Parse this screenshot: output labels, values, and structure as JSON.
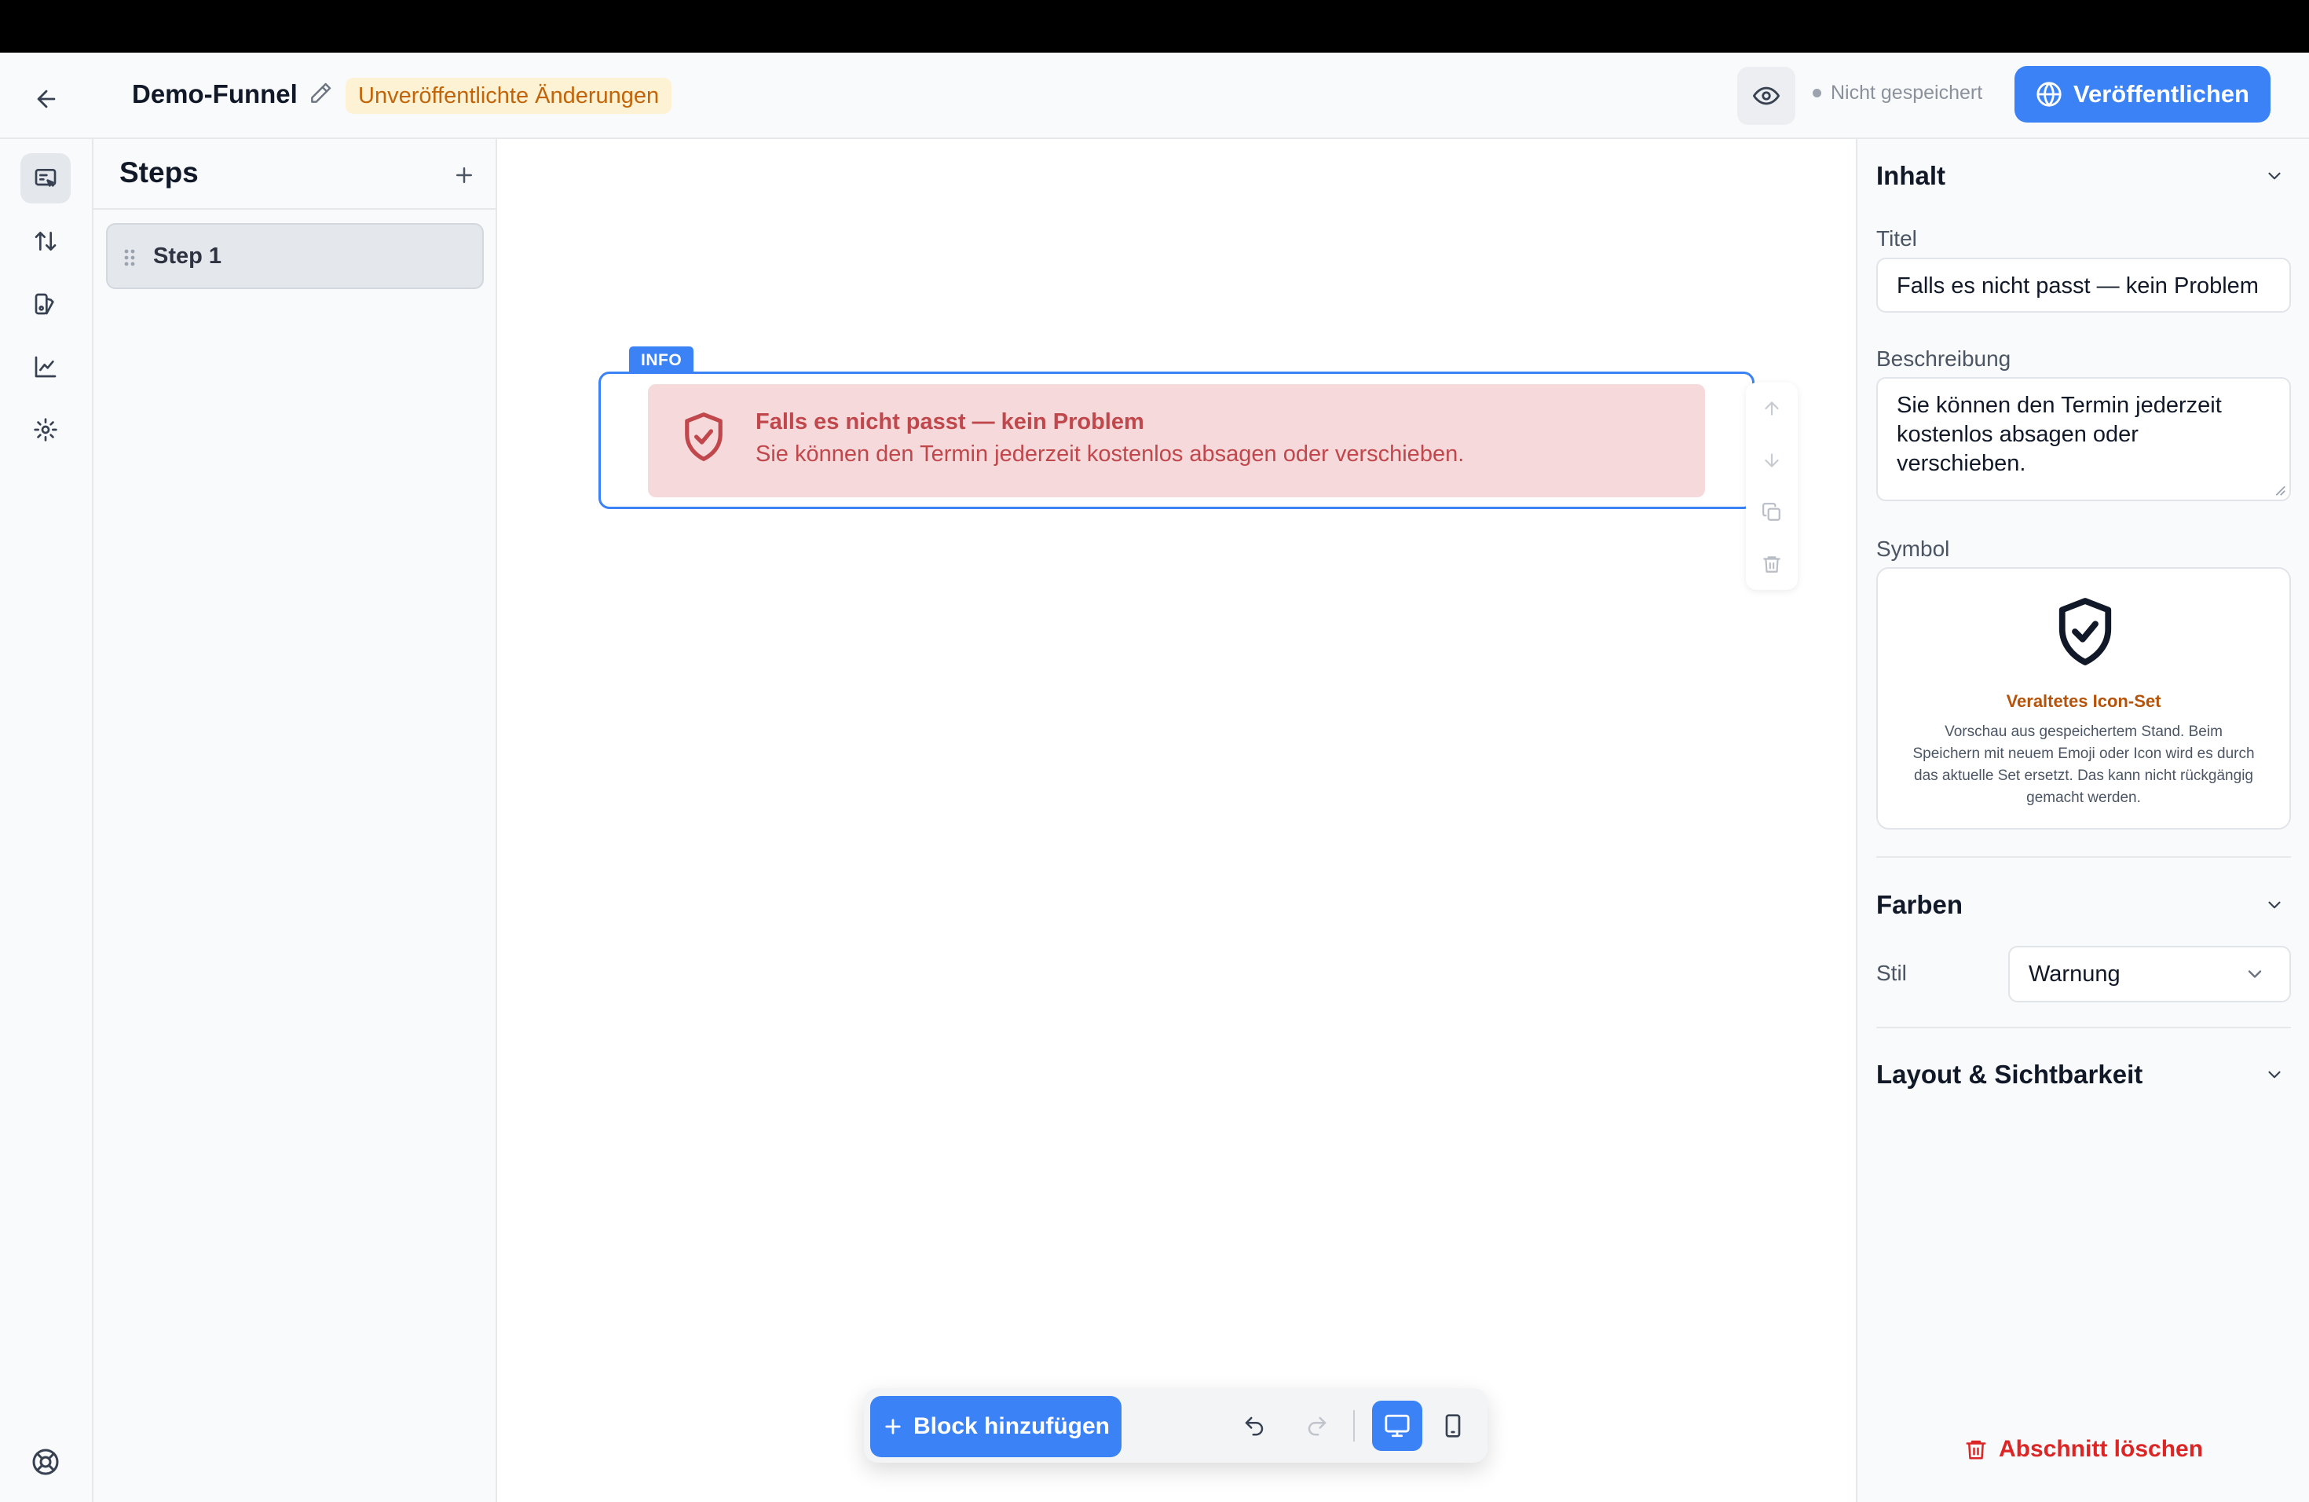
{
  "header": {
    "back_label": "",
    "funnel_name": "Demo-Funnel",
    "unpublished_badge": "Unveröffentlichte Änderungen",
    "save_status": "Nicht gespeichert",
    "publish_label": "Veröffentlichen"
  },
  "rail": {
    "items": [
      "editor-icon",
      "sort-icon",
      "theme-icon",
      "analytics-icon",
      "settings-icon"
    ],
    "help": "help-icon"
  },
  "steps": {
    "title": "Steps",
    "items": [
      {
        "label": "Step 1",
        "active": true
      }
    ]
  },
  "canvas": {
    "block_tag": "INFO",
    "alert": {
      "icon": "shield-check-icon",
      "title": "Falls es nicht passt — kein Problem",
      "description": "Sie können den Termin jederzeit kostenlos absagen oder verschieben.",
      "color": "#c0474c",
      "background": "#f6d9da"
    },
    "block_tools": [
      "arrow-up-icon",
      "arrow-down-icon",
      "duplicate-icon",
      "trash-icon"
    ]
  },
  "toolbar": {
    "add_block_label": "Block hinzufügen",
    "device": "desktop"
  },
  "props": {
    "content_section": "Inhalt",
    "title_label": "Titel",
    "title_value": "Falls es nicht passt — kein Problem",
    "description_label": "Beschreibung",
    "description_value": "Sie können den Termin jederzeit kostenlos absagen oder verschieben.",
    "symbol_label": "Symbol",
    "symbol_icon": "shield-check-icon",
    "legacy_title": "Veraltetes Icon-Set",
    "legacy_text": "Vorschau aus gespeichertem Stand. Beim Speichern mit neuem Emoji oder Icon wird es durch das aktuelle Set ersetzt. Das kann nicht rückgängig gemacht werden.",
    "colors_section": "Farben",
    "style_label": "Stil",
    "style_value": "Warnung",
    "layout_section": "Layout & Sichtbarkeit",
    "delete_label": "Abschnitt löschen"
  },
  "colors": {
    "accent": "#3b82f6",
    "danger": "#dc2626",
    "badge_text": "#c2650a",
    "badge_bg": "#fdf3d4"
  }
}
